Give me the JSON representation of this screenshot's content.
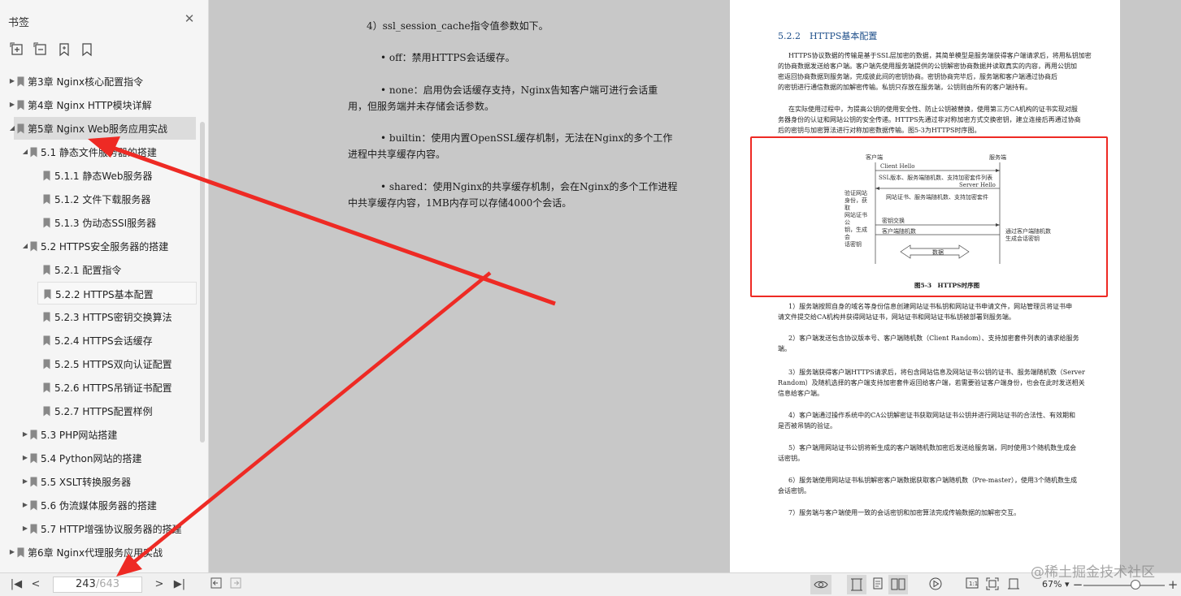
{
  "sidebar": {
    "title": "书签",
    "tools": [
      "expand-all-icon",
      "collapse-all-icon",
      "add-bookmark-icon",
      "bookmark-icon"
    ],
    "items": [
      {
        "label": "第3章 Nginx核心配置指令",
        "level": 0,
        "state": "collapsed"
      },
      {
        "label": "第4章 Nginx HTTP模块详解",
        "level": 0,
        "state": "collapsed"
      },
      {
        "label": "第5章 Nginx Web服务应用实战",
        "level": 0,
        "state": "expanded",
        "selected": true
      },
      {
        "label": "5.1 静态文件服务器的搭建",
        "level": 1,
        "state": "expanded"
      },
      {
        "label": "5.1.1 静态Web服务器",
        "level": 2
      },
      {
        "label": "5.1.2 文件下载服务器",
        "level": 2
      },
      {
        "label": "5.1.3 伪动态SSI服务器",
        "level": 2
      },
      {
        "label": "5.2 HTTPS安全服务器的搭建",
        "level": 1,
        "state": "expanded"
      },
      {
        "label": "5.2.1 配置指令",
        "level": 2
      },
      {
        "label": "5.2.2 HTTPS基本配置",
        "level": 2,
        "hovered": true
      },
      {
        "label": "5.2.3 HTTPS密钥交换算法",
        "level": 2
      },
      {
        "label": "5.2.4 HTTPS会话缓存",
        "level": 2
      },
      {
        "label": "5.2.5 HTTPS双向认证配置",
        "level": 2
      },
      {
        "label": "5.2.6 HTTPS吊销证书配置",
        "level": 2
      },
      {
        "label": "5.2.7 HTTPS配置样例",
        "level": 2
      },
      {
        "label": "5.3 PHP网站搭建",
        "level": 1,
        "state": "collapsed"
      },
      {
        "label": "5.4 Python网站的搭建",
        "level": 1,
        "state": "collapsed"
      },
      {
        "label": "5.5 XSLT转换服务器",
        "level": 1,
        "state": "collapsed"
      },
      {
        "label": "5.6 伪流媒体服务器的搭建",
        "level": 1,
        "state": "collapsed"
      },
      {
        "label": "5.7 HTTP增强协议服务器的搭建",
        "level": 1,
        "state": "collapsed"
      },
      {
        "label": "第6章 Nginx代理服务应用实战",
        "level": 0,
        "state": "collapsed"
      }
    ]
  },
  "left_page": {
    "lines": [
      "4）ssl_session_cache指令值参数如下。",
      "• off：禁用HTTPS会话缓存。",
      "• none：启用伪会话缓存支持，Nginx告知客户端可进行会话重",
      "用，但服务端并未存储会话参数。",
      "• builtin：使用内置OpenSSL缓存机制，无法在Nginx的多个工作",
      "进程中共享缓存内容。",
      "• shared：使用Nginx的共享缓存机制，会在Nginx的多个工作进程",
      "中共享缓存内容，1MB内存可以存储4000个会话。"
    ]
  },
  "right_page": {
    "heading": "5.2.2　HTTPS基本配置",
    "intro": [
      "HTTPS协议数据的传输是基于SSL层加密的数据，其简单模型是服务端获得客户端请求后，将用私钥加密",
      "的协商数据发送给客户端。客户端先使用服务端提供的公钥解密协商数据并读取真实的内容，再用公钥加",
      "密返回协商数据到服务端，完成彼此间的密钥协商。密钥协商完毕后，服务端和客户端通过协商后",
      "的密钥进行通信数据的加解密传输。私钥只存放在服务端，公钥则由所有的客户端持有。",
      "在实际使用过程中，为提高公钥的使用安全性、防止公钥被替换，使用第三方CA机构的证书实现对服",
      "务器身份的认证和网站公钥的安全传递。HTTPS先通过非对称加密方式交换密钥，建立连接后再通过协商",
      "后的密钥与加密算法进行对称加密数据传输。图5-3为HTTPS时序图。"
    ],
    "figure": {
      "client_label": "客户端",
      "server_label": "服务端",
      "client_hello": "Client Hello",
      "ssl_info": "SSL版本、服务端随机数、支持加密套件列表",
      "server_hello": "Server Hello",
      "server_cert": "网站证书、服务端随机数、支持加密套件",
      "left_note": [
        "验证网站",
        "身份，获取",
        "网站证书公",
        "钥，生成会",
        "话密钥"
      ],
      "key_exchange": "密钥交换",
      "client_random": "客户端随机数",
      "right_note": [
        "通过客户端随机数",
        "生成会话密钥"
      ],
      "data_label": "数据",
      "caption": "图5-3　HTTPS时序图"
    },
    "steps": [
      "1）服务端按照自身的域名等身份信息创建网站证书私钥和网站证书申请文件，网站管理员将证书申",
      "请文件提交给CA机构并获得网站证书，网站证书和网站证书私钥被部署到服务端。",
      "2）客户端发送包含协议版本号、客户端随机数（Client Random）、支持加密套件列表的请求给服务",
      "端。",
      "3）服务端获得客户端HTTPS请求后，将包含网站信息及网站证书公钥的证书、服务端随机数（Server",
      "Random）及随机选择的客户端支持加密套件返回给客户端，若需要验证客户端身份，也会在此时发送相关",
      "信息给客户端。",
      "4）客户端通过操作系统中的CA公钥解密证书获取网站证书公钥并进行网站证书的合法性、有效期和",
      "是否被吊销的验证。",
      "5）客户端用网站证书公钥将新生成的客户端随机数加密后发送给服务端，同时使用3个随机数生成会",
      "话密钥。",
      "6）服务端使用网站证书私钥解密客户端数据获取客户端随机数（Pre-master），使用3个随机数生成",
      "会话密钥。",
      "7）服务端与客户端使用一致的会话密钥和加密算法完成传输数据的加解密交互。"
    ]
  },
  "toolbar": {
    "page_current": "243",
    "page_total": "/643",
    "zoom": "67%",
    "zoom_fraction": 0.67,
    "watermark": "@稀土掘金技术社区"
  },
  "colors": {
    "annotation_red": "#ee2a24",
    "heading_blue": "#1e4f8a",
    "sidebar_bg": "#f5f5f5"
  }
}
